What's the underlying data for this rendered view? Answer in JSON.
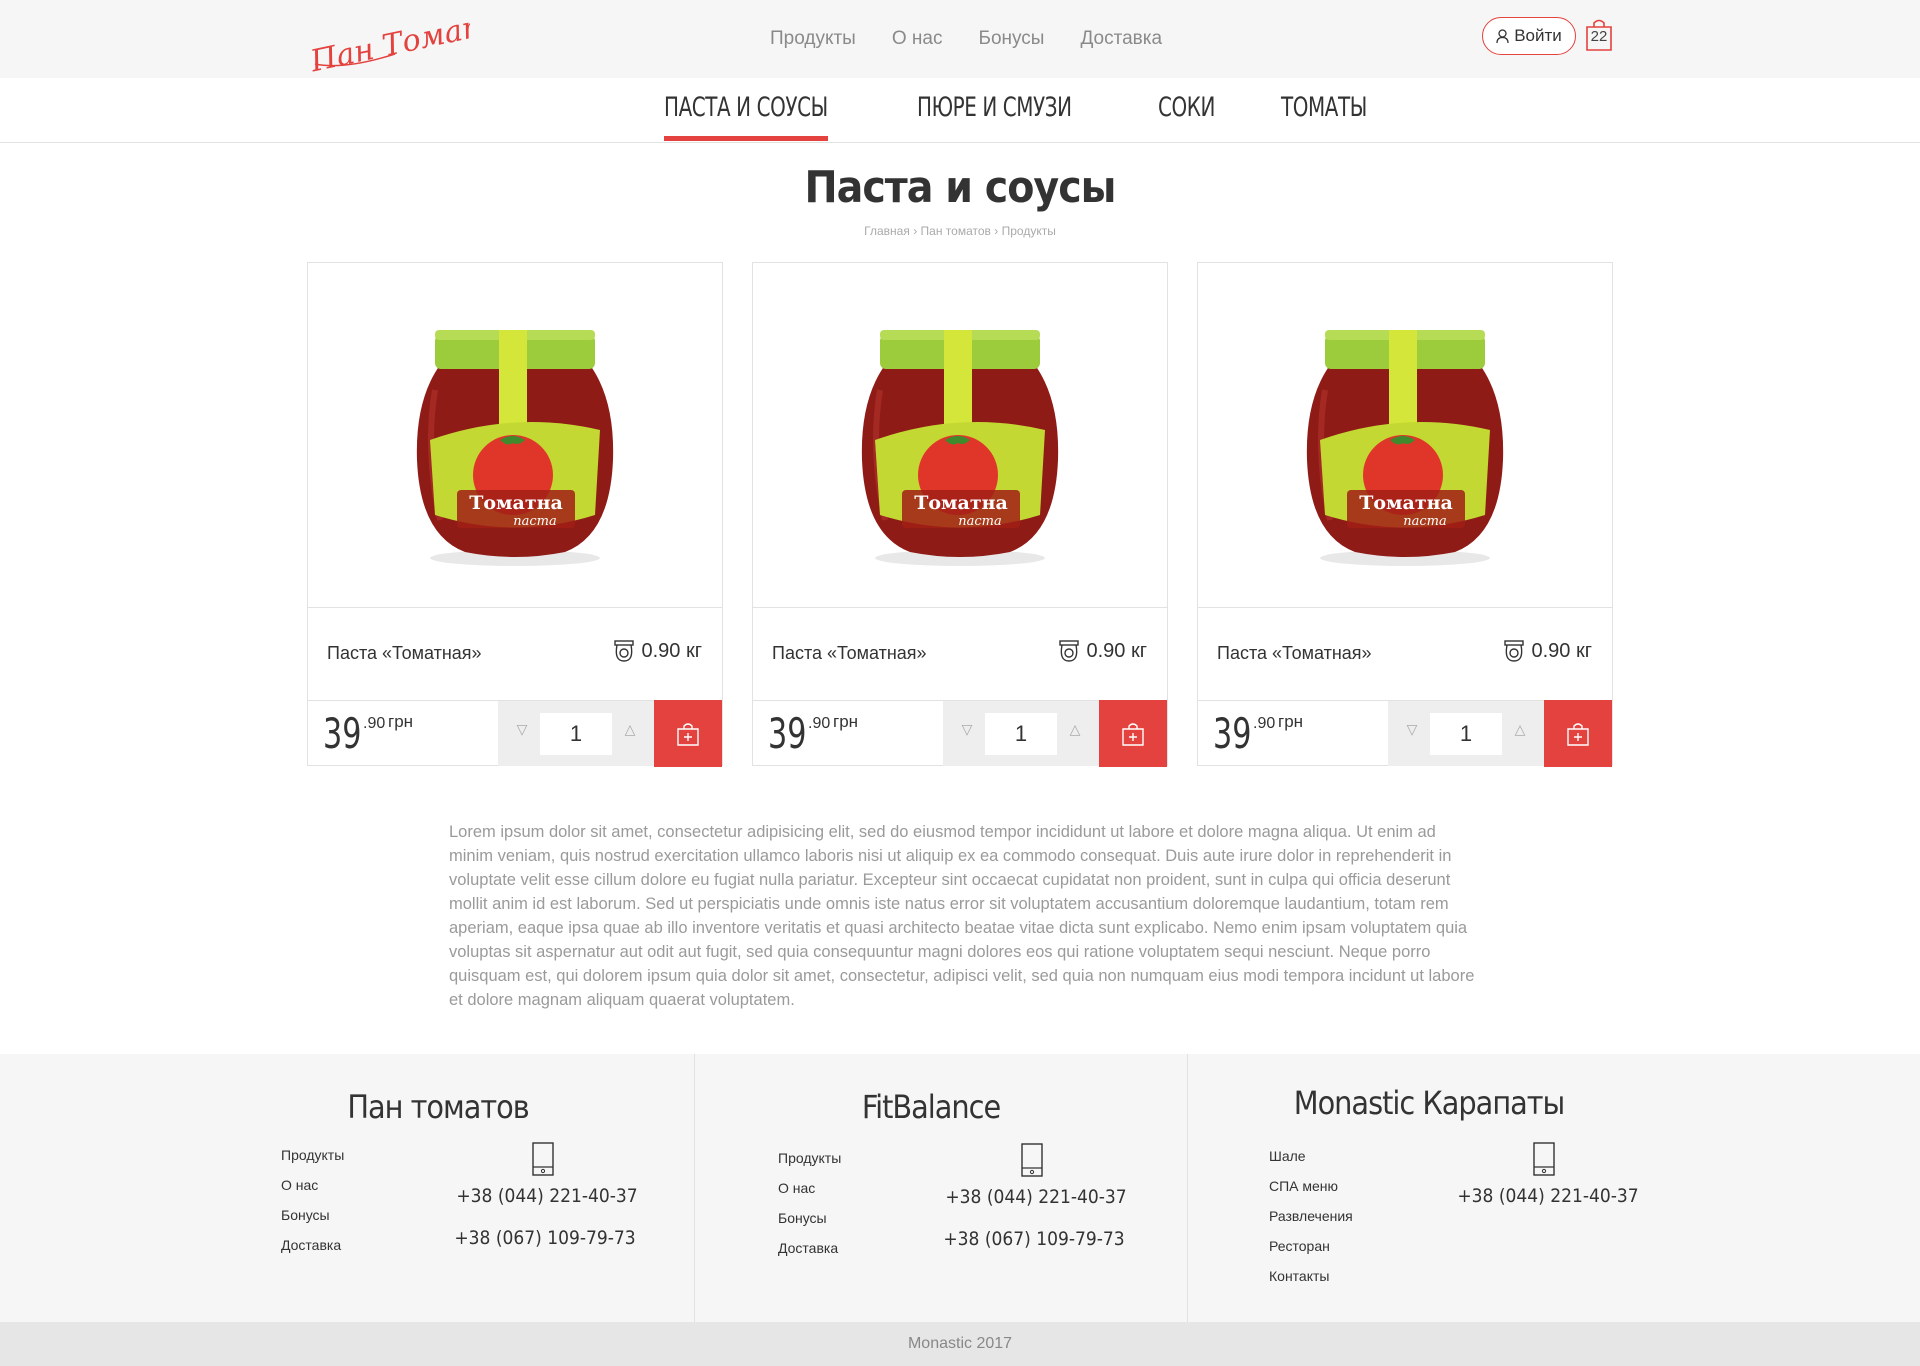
{
  "header": {
    "logo_text": "Пан Томатов",
    "nav": [
      "Продукты",
      "О нас",
      "Бонусы",
      "Доставка"
    ],
    "login_label": "Войти",
    "cart_count": "22"
  },
  "categories": [
    {
      "label": "ПАСТА И СОУСЫ",
      "active": true
    },
    {
      "label": "ПЮРЕ И СМУЗИ",
      "active": false
    },
    {
      "label": "СОКИ",
      "active": false
    },
    {
      "label": "ТОМАТЫ",
      "active": false
    }
  ],
  "page": {
    "title": "Паста и соусы",
    "breadcrumb": [
      "Главная",
      "Пан томатов",
      "Продукты"
    ]
  },
  "products": [
    {
      "name": "Паста «Томатная»",
      "weight": "0.90 кг",
      "price_main": "39",
      "price_cents": ".90",
      "currency": "грн",
      "qty": "1"
    },
    {
      "name": "Паста «Томатная»",
      "weight": "0.90 кг",
      "price_main": "39",
      "price_cents": ".90",
      "currency": "грн",
      "qty": "1"
    },
    {
      "name": "Паста «Томатная»",
      "weight": "0.90 кг",
      "price_main": "39",
      "price_cents": ".90",
      "currency": "грн",
      "qty": "1"
    }
  ],
  "jar_label": {
    "line1": "Томатна",
    "line2": "паста"
  },
  "description": "Lorem ipsum dolor sit amet, consectetur adipisicing elit, sed do eiusmod tempor incididunt ut labore et dolore magna aliqua. Ut enim ad minim veniam, quis nostrud exercitation ullamco laboris nisi ut aliquip ex ea commodo consequat. Duis aute irure dolor in reprehenderit in voluptate velit esse cillum dolore eu fugiat nulla pariatur. Excepteur sint occaecat cupidatat non proident, sunt in culpa qui officia deserunt mollit anim id est laborum. Sed ut perspiciatis unde omnis iste natus error sit voluptatem accusantium doloremque laudantium, totam rem aperiam, eaque ipsa quae ab illo inventore veritatis et quasi architecto beatae vitae dicta sunt explicabo. Nemo enim ipsam voluptatem quia voluptas sit aspernatur aut odit aut fugit, sed quia consequuntur magni dolores eos qui ratione voluptatem sequi nesciunt. Neque porro quisquam est, qui dolorem ipsum quia dolor sit amet, consectetur, adipisci velit, sed quia non numquam eius modi tempora incidunt ut labore et dolore magnam aliquam quaerat voluptatem.",
  "footer": {
    "columns": [
      {
        "title": "Пан томатов",
        "links": [
          "Продукты",
          "О нас",
          "Бонусы",
          "Доставка"
        ],
        "phones": [
          "+38 (044) 221-40-37",
          "+38 (067) 109-79-73"
        ]
      },
      {
        "title": "FitBalance",
        "links": [
          "Продукты",
          "О нас",
          "Бонусы",
          "Доставка"
        ],
        "phones": [
          "+38 (044) 221-40-37",
          "+38 (067) 109-79-73"
        ]
      },
      {
        "title": "Monastic Карапаты",
        "links": [
          "Шале",
          "СПА меню",
          "Развлечения",
          "Ресторан",
          "Контакты"
        ],
        "phones": [
          "+38 (044) 221-40-37"
        ]
      }
    ],
    "copyright": "Monastic 2017"
  },
  "colors": {
    "accent": "#e3423e",
    "topbar": "#f6f6f6",
    "jar_lid": "#9ccb3b",
    "jar_body": "#8f1b17"
  }
}
